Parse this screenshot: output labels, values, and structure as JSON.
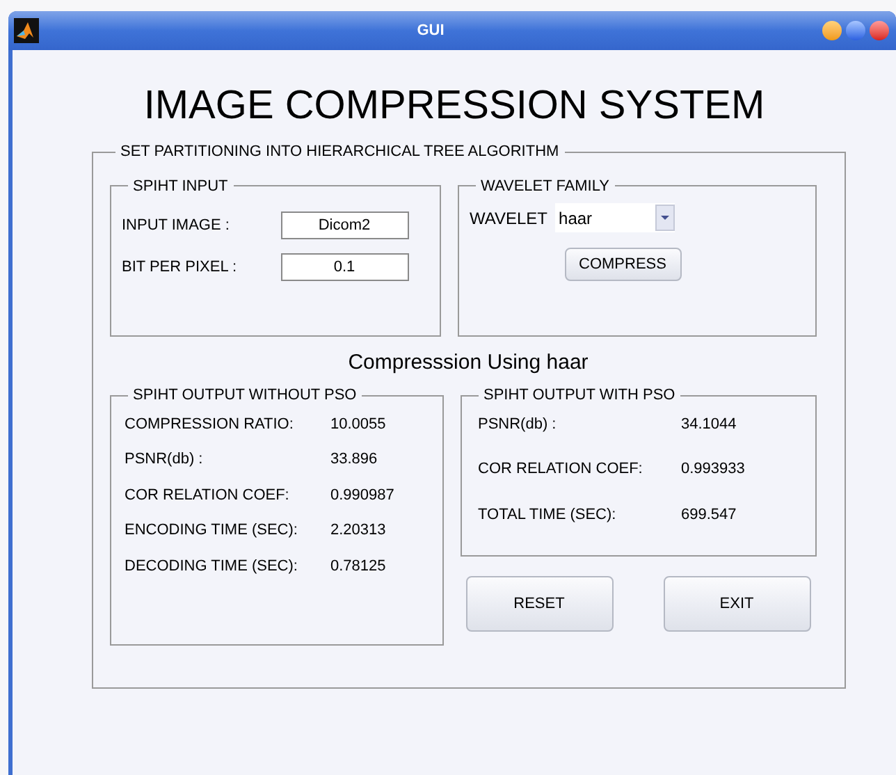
{
  "window": {
    "title": "GUI"
  },
  "heading": "IMAGE COMPRESSION SYSTEM",
  "main_group": {
    "title": "SET PARTITIONING INTO HIERARCHICAL TREE ALGORITHM"
  },
  "spiht_input": {
    "title": "SPIHT INPUT",
    "fields": [
      {
        "label": "INPUT IMAGE :",
        "value": "Dicom2"
      },
      {
        "label": "BIT PER PIXEL :",
        "value": "0.1"
      }
    ]
  },
  "wavelet_family": {
    "title": "WAVELET FAMILY",
    "label": "WAVELET",
    "value": "haar",
    "button": "COMPRESS"
  },
  "status": "Compresssion Using haar",
  "output_without_pso": {
    "title": "SPIHT OUTPUT WITHOUT PSO",
    "rows": [
      {
        "label": "COMPRESSION RATIO:",
        "value": "10.0055"
      },
      {
        "label": "PSNR(db) :",
        "value": "33.896"
      },
      {
        "label": "COR RELATION COEF:",
        "value": "0.990987"
      },
      {
        "label": "ENCODING TIME (SEC):",
        "value": "2.20313"
      },
      {
        "label": "DECODING TIME (SEC):",
        "value": "0.78125"
      }
    ]
  },
  "output_with_pso": {
    "title": "SPIHT OUTPUT WITH PSO",
    "rows": [
      {
        "label": "PSNR(db) :",
        "value": "34.1044"
      },
      {
        "label": "COR RELATION COEF:",
        "value": "0.993933"
      },
      {
        "label": "TOTAL TIME (SEC):",
        "value": "699.547"
      }
    ]
  },
  "buttons": [
    "RESET",
    "EXIT"
  ]
}
